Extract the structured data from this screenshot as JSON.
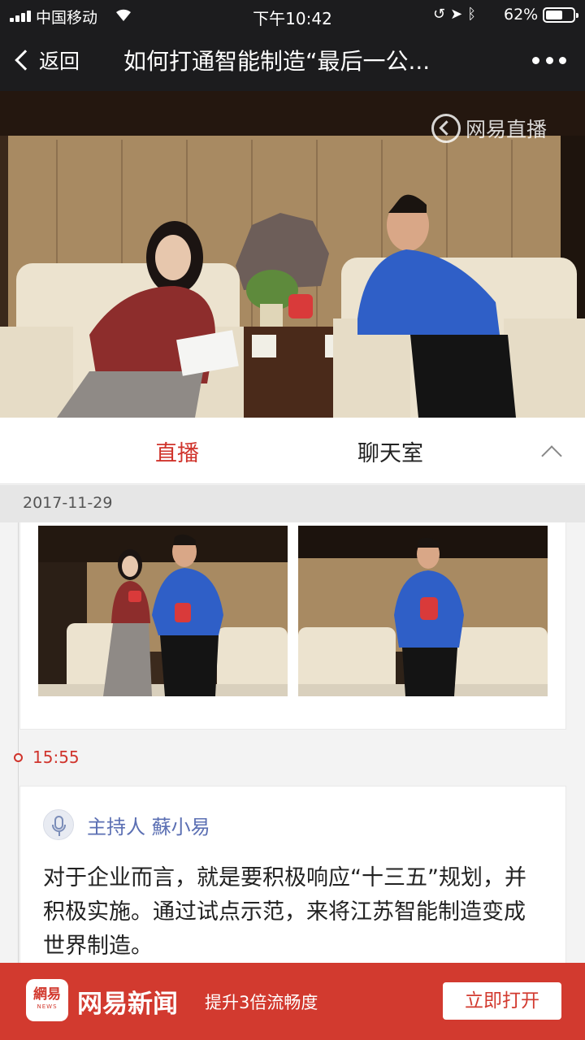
{
  "status_bar": {
    "carrier": "中国移动",
    "time": "下午10:42",
    "battery_percent": "62%",
    "battery_level": 0.62
  },
  "nav": {
    "back_label": "返回",
    "title": "如何打通智能制造“最后一公..."
  },
  "video": {
    "watermark": "网易直播"
  },
  "tabs": {
    "live": "直播",
    "chat": "聊天室"
  },
  "feed": {
    "date": "2017-11-29",
    "post_time": "15:55",
    "author": "主持人 蘇小易",
    "text": "对于企业而言，就是要积极响应“十三五”规划，并积极实施。通过试点示范，来将江苏智能制造变成世界制造。"
  },
  "banner": {
    "logo_text": "網易",
    "logo_sub": "NEWS",
    "app_name": "网易新闻",
    "slogan": "提升3倍流畅度",
    "open_label": "立即打开"
  },
  "colors": {
    "accent": "#d0342c",
    "banner": "#d23a2f",
    "author": "#5b6fb3"
  },
  "icons": [
    "signal-icon",
    "wifi-icon",
    "lock-rotation-icon",
    "location-icon",
    "bluetooth-icon",
    "battery-icon",
    "back-chevron-icon",
    "more-dots-icon",
    "collapse-chevron-icon",
    "mic-avatar-icon"
  ]
}
